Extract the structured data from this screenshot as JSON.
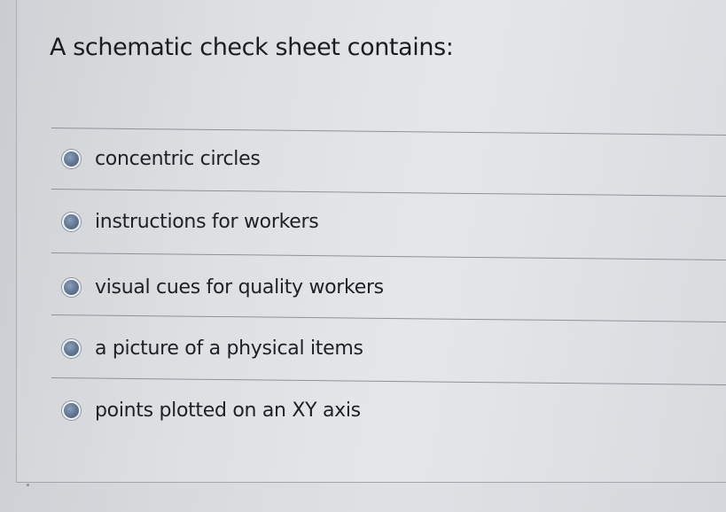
{
  "question": {
    "text": "A schematic check sheet contains:"
  },
  "options": [
    {
      "label": "concentric circles",
      "selected": false
    },
    {
      "label": "instructions for workers",
      "selected": false
    },
    {
      "label": "visual cues for quality workers",
      "selected": false
    },
    {
      "label": "a picture of a physical items",
      "selected": false
    },
    {
      "label": "points plotted on an XY axis",
      "selected": false
    }
  ]
}
